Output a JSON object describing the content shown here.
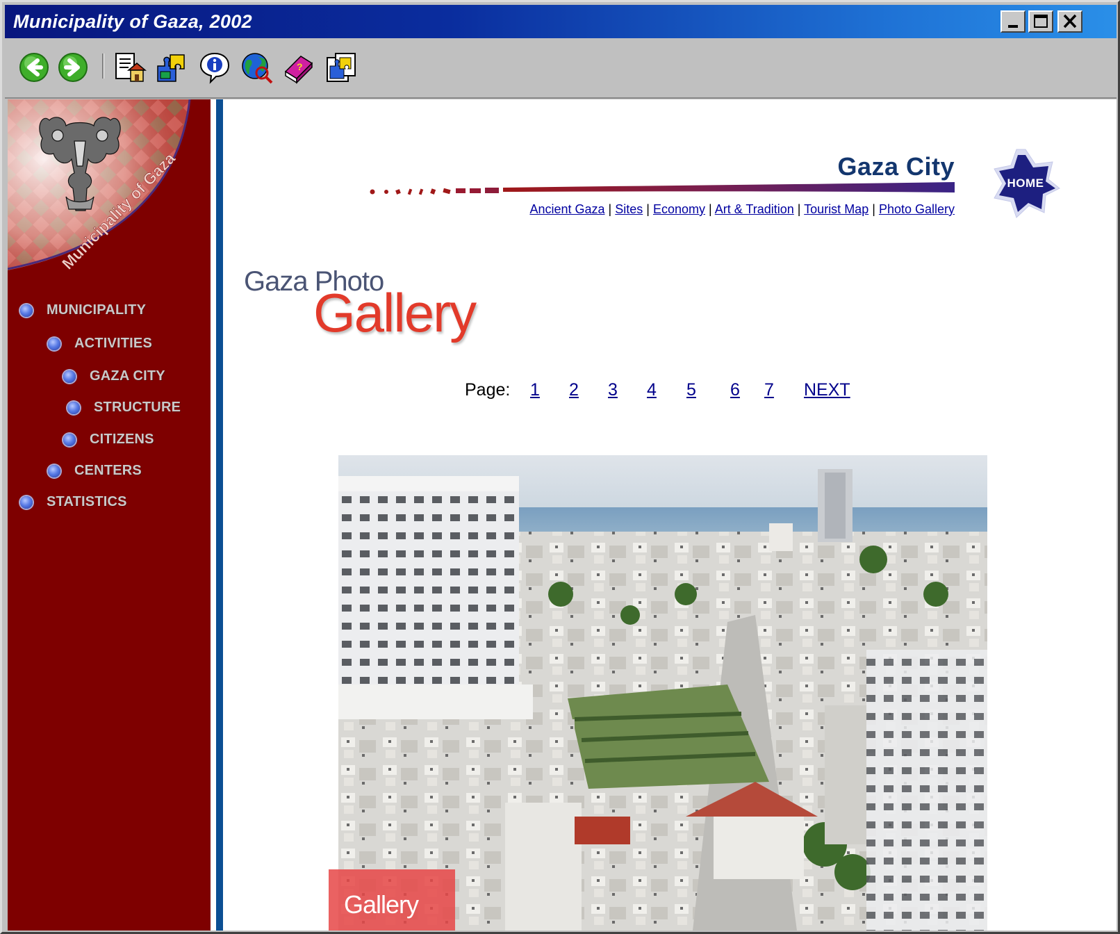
{
  "window": {
    "title": "Municipality of Gaza, 2002",
    "controls": [
      "minimize",
      "maximize",
      "close"
    ]
  },
  "toolbar": {
    "icons": [
      "back-arrow-icon",
      "forward-arrow-icon",
      "home-document-icon",
      "puzzle-icon",
      "info-icon",
      "globe-icon",
      "book-icon",
      "puzzle-frame-icon"
    ]
  },
  "sidebar": {
    "logo_text": "Municipality of Gaza",
    "items": [
      {
        "label": "MUNICIPALITY"
      },
      {
        "label": "ACTIVITIES"
      },
      {
        "label": "GAZA CITY"
      },
      {
        "label": "STRUCTURE"
      },
      {
        "label": "CITIZENS"
      },
      {
        "label": "CENTERS"
      },
      {
        "label": "STATISTICS"
      }
    ]
  },
  "header": {
    "title": "Gaza City",
    "home_label": "HOME",
    "links": [
      {
        "label": "Ancient Gaza"
      },
      {
        "label": "Sites"
      },
      {
        "label": "Economy"
      },
      {
        "label": "Art & Tradition"
      },
      {
        "label": "Tourist Map"
      },
      {
        "label": "Photo Gallery"
      }
    ],
    "separator": "|"
  },
  "gallery": {
    "logo_line1": "Gaza Photo",
    "logo_line2": "Gallery",
    "pager_label": "Page:",
    "pages": [
      "1",
      "2",
      "3",
      "4",
      "5",
      "6",
      "7"
    ],
    "next_label": "NEXT",
    "photo_tag": "Gallery"
  },
  "colors": {
    "sidebar_bg": "#7e0000",
    "title_gradient_start": "#08167e",
    "heading": "#13366e",
    "gallery_red": "#e23a2a",
    "link": "#0000a0"
  }
}
